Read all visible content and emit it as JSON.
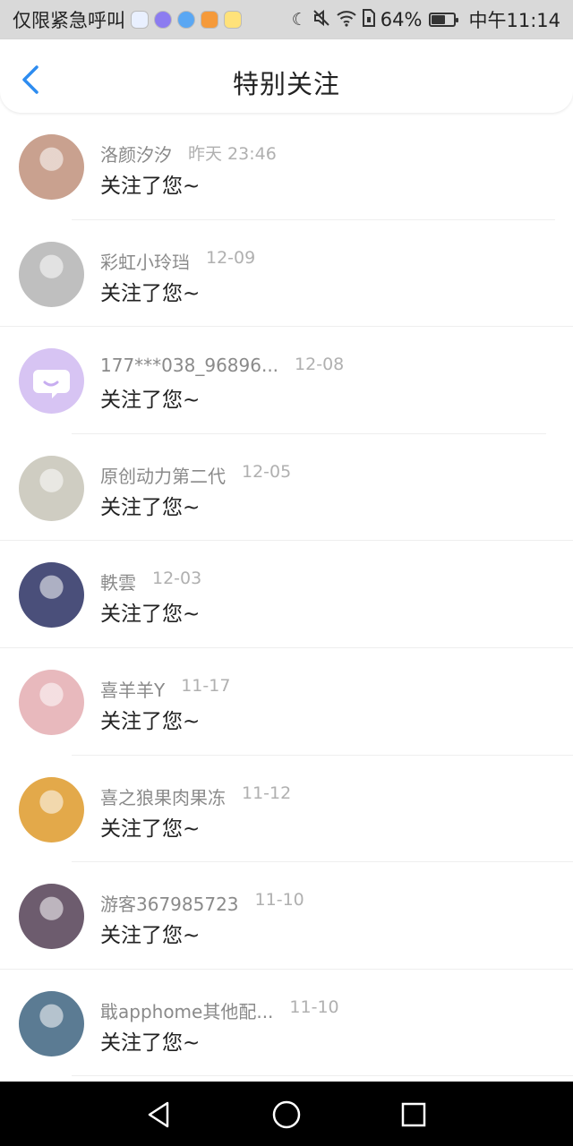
{
  "status_bar": {
    "carrier": "仅限紧急呼叫",
    "battery": "64%",
    "time": "中午11:14",
    "battery_level": 0.64,
    "icons": [
      "app-baidu-icon",
      "app-music-icon",
      "app-browser-icon",
      "app-video-icon",
      "app-assistant-icon",
      "moon-icon",
      "mute-icon",
      "wifi-icon",
      "sim-icon",
      "battery-icon"
    ]
  },
  "header": {
    "title": "特别关注",
    "back_icon": "chevron-left-icon",
    "accent": "#2d8cf0"
  },
  "items": [
    {
      "name": "洛颜汐汐",
      "time": "昨天 23:46",
      "message": "关注了您~",
      "avatar": "#c9a18f"
    },
    {
      "name": "彩虹小玲珰",
      "time": "12-09",
      "message": "关注了您~",
      "avatar": "#bfbfbf"
    },
    {
      "name": "177***038_96896...",
      "time": "12-08",
      "message": "关注了您~",
      "avatar": "#d7c4f3"
    },
    {
      "name": "原创动力第二代",
      "time": "12-05",
      "message": "关注了您~",
      "avatar": "#cfcdc2"
    },
    {
      "name": "軼雲",
      "time": "12-03",
      "message": "关注了您~",
      "avatar": "#4a4f7a"
    },
    {
      "name": "喜羊羊Y",
      "time": "11-17",
      "message": "关注了您~",
      "avatar": "#e8b9bd"
    },
    {
      "name": "喜之狼果肉果冻",
      "time": "11-12",
      "message": "关注了您~",
      "avatar": "#e3a94a"
    },
    {
      "name": "游客367985723",
      "time": "11-10",
      "message": "关注了您~",
      "avatar": "#6d5c6e"
    },
    {
      "name": "戢apphome其他配...",
      "time": "11-10",
      "message": "关注了您~",
      "avatar": "#5b7b93"
    }
  ],
  "navbar": {
    "icons": [
      "back-triangle-icon",
      "home-circle-icon",
      "recents-square-icon"
    ]
  }
}
